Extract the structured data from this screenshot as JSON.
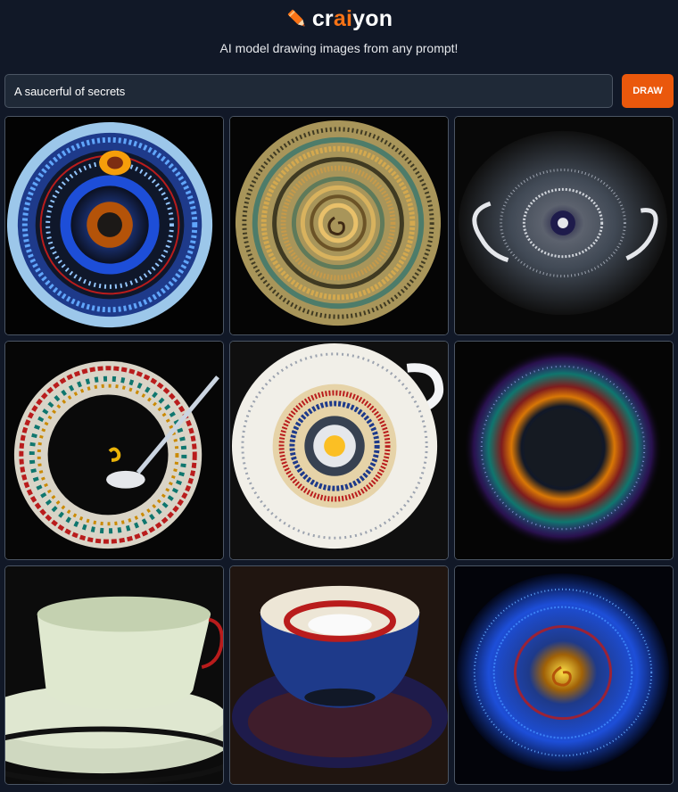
{
  "header": {
    "logo": {
      "pre": "cr",
      "accent": "ai",
      "post": "yon"
    },
    "tagline": "AI model drawing images from any prompt!"
  },
  "prompt": {
    "value": "A saucerful of secrets",
    "button_label": "DRAW"
  },
  "colors": {
    "background": "#111827",
    "accent": "#ea580c",
    "input_bg": "#1f2937",
    "border": "#4b5563"
  },
  "results": [
    {
      "name": "result-image-1",
      "icon": "blue-circular-disc-image"
    },
    {
      "name": "result-image-2",
      "icon": "golden-spiral-disc-image"
    },
    {
      "name": "result-image-3",
      "icon": "grey-vortex-image"
    },
    {
      "name": "result-image-4",
      "icon": "decorated-saucer-with-spoon-image"
    },
    {
      "name": "result-image-5",
      "icon": "white-teacup-top-view-image"
    },
    {
      "name": "result-image-6",
      "icon": "glowing-nebula-ring-image"
    },
    {
      "name": "result-image-7",
      "icon": "pale-green-teacup-image"
    },
    {
      "name": "result-image-8",
      "icon": "blue-teacup-on-saucer-image"
    },
    {
      "name": "result-image-9",
      "icon": "blue-spiral-vortex-image"
    }
  ]
}
